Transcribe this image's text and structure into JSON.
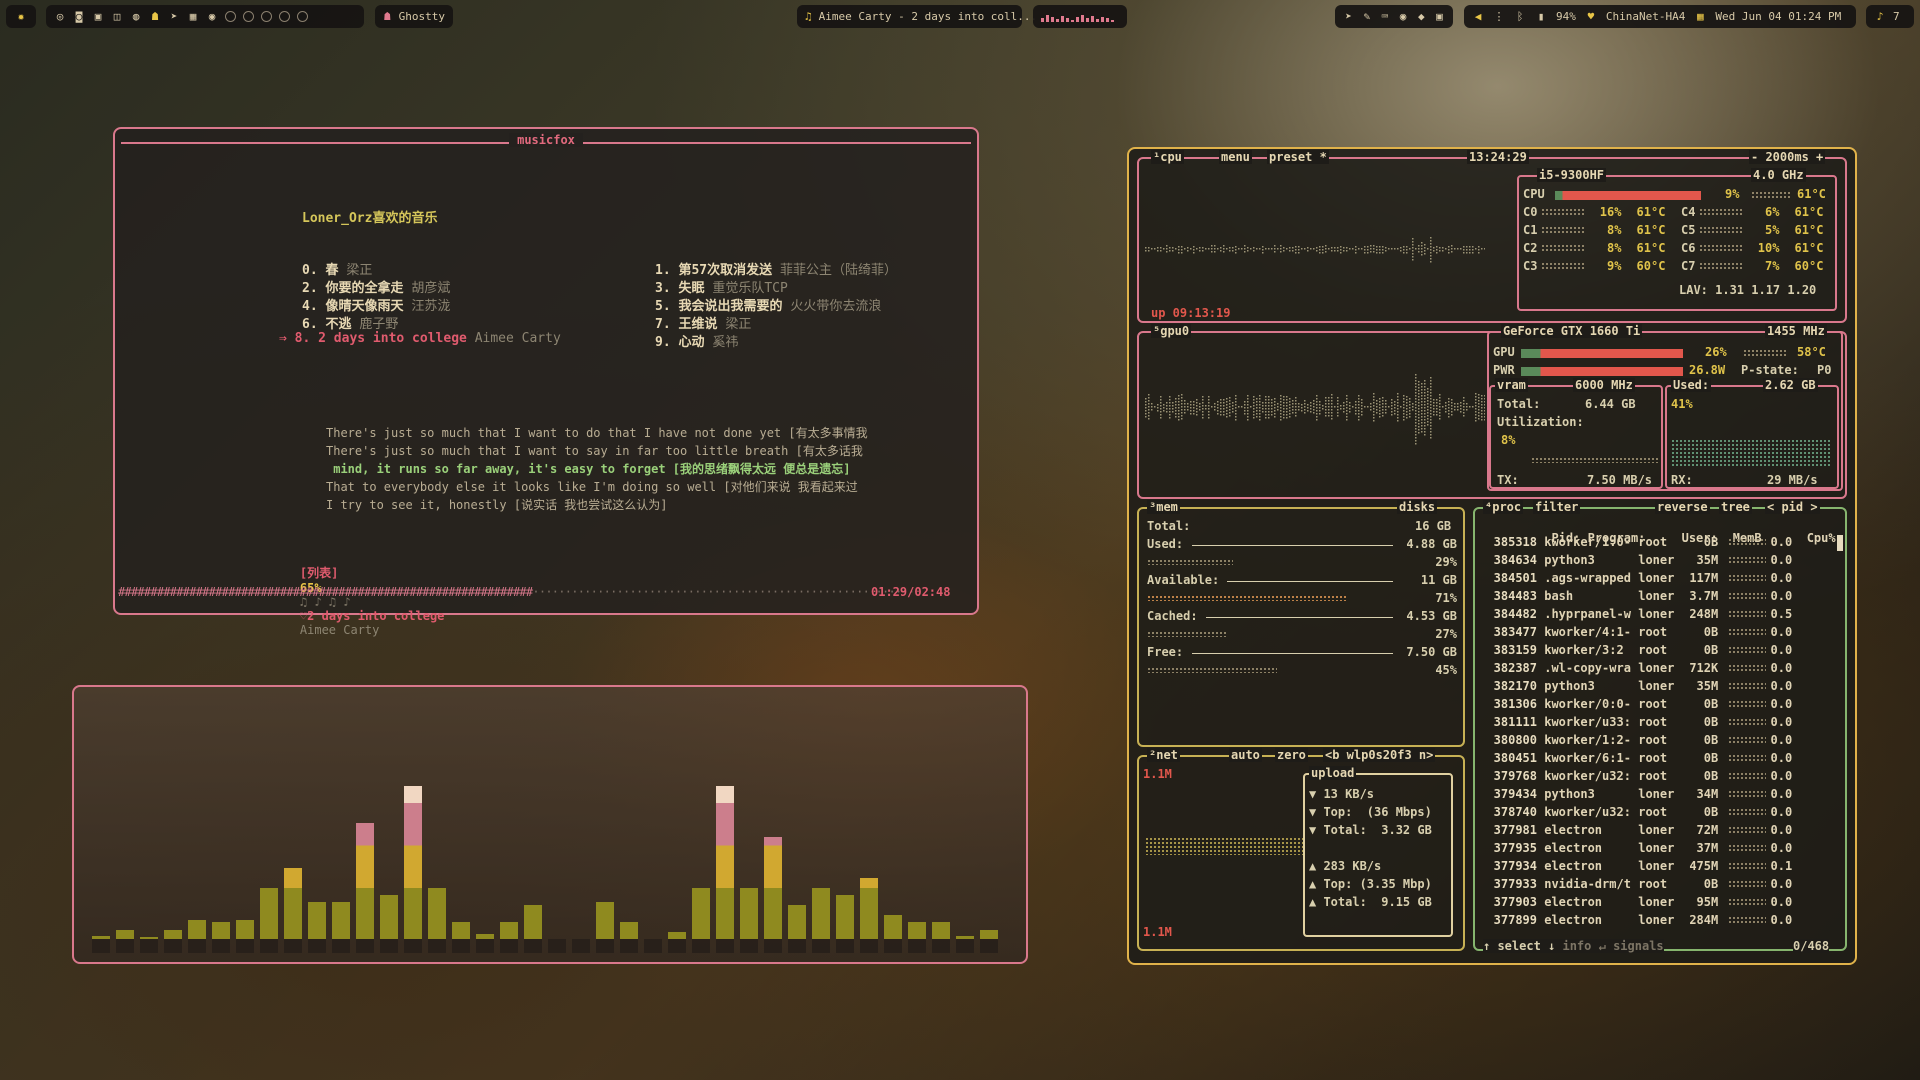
{
  "topbar": {
    "app_label": "Ghostty",
    "now_playing": "Aimee Carty - 2 days into coll...",
    "battery": "94%",
    "wifi": "ChinaNet-HA4",
    "datetime": "Wed Jun 04  01:24 PM",
    "notif_count": "7"
  },
  "musicfox": {
    "title": "musicfox",
    "playlist_title": "Loner_Orz喜欢的音乐",
    "songs_left": [
      {
        "num": "0.",
        "title": "春",
        "artist": "梁正"
      },
      {
        "num": "2.",
        "title": "你要的全拿走",
        "artist": "胡彦斌"
      },
      {
        "num": "4.",
        "title": "像晴天像雨天",
        "artist": "汪苏泷"
      },
      {
        "num": "6.",
        "title": "不逃",
        "artist": "鹿子野"
      }
    ],
    "playing_row": {
      "marker": "⇒",
      "num": "8.",
      "title": "2 days into college",
      "artist": "Aimee Carty"
    },
    "songs_right": [
      {
        "num": "1.",
        "title": "第57次取消发送",
        "artist": "菲菲公主（陆绮菲）"
      },
      {
        "num": "3.",
        "title": "失眠",
        "artist": "重觉乐队TCP"
      },
      {
        "num": "5.",
        "title": "我会说出我需要的",
        "artist": "火火带你去流浪"
      },
      {
        "num": "7.",
        "title": "王维说",
        "artist": "梁正"
      },
      {
        "num": "9.",
        "title": "心动",
        "artist": "奚祎"
      }
    ],
    "lyrics": [
      "There's just so much that I want to do that I have not done yet [有太多事情我",
      "There's just so much that I want to say in far too little breath [有太多话我",
      " mind, it runs so far away, it's easy to forget [我的思绪飘得太远 便总是遗忘]",
      "That to everybody else it looks like I'm doing so well [对他们来说 我看起来过",
      "I try to see it, honestly [说实话 我也尝试这么认为]"
    ],
    "status": {
      "list_tag": "[列表]",
      "volume": "65%",
      "notes": "♫ ♪ ♫ ♪",
      "heart": "♡",
      "song": "2 days into college",
      "artist": "Aimee Carty"
    },
    "progress": 0.607,
    "progress_bar": {
      "done": "################################################################",
      "remain": "···························································"
    },
    "time": "01:29/02:48"
  },
  "visualizer": {
    "bars": [
      0.02,
      0.05,
      0.01,
      0.05,
      0.11,
      0.1,
      0.11,
      0.3,
      0.42,
      0.22,
      0.22,
      0.68,
      0.26,
      0.9,
      0.3,
      0.1,
      0.03,
      0.1,
      0.2,
      0,
      0,
      0.22,
      0.1,
      0,
      0.04,
      0.3,
      0.9,
      0.3,
      0.6,
      0.2,
      0.3,
      0.26,
      0.36,
      0.14,
      0.1,
      0.1,
      0.02,
      0.05
    ],
    "colors": {
      "low": "#8f8a1f",
      "mid": "#d1a830",
      "high": "#cc7e8c",
      "top": "#f1d7c2"
    }
  },
  "btop": {
    "cpu": {
      "label": "¹cpu",
      "menu": "menu",
      "preset": "preset *",
      "clock": "13:24:29",
      "interval": "- 2000ms +",
      "uptime": "up 09:13:19",
      "model": "i5-9300HF",
      "freq": "4.0 GHz",
      "total": {
        "name": "CPU",
        "pct": "9%",
        "temp": "61°C",
        "value": 0.9
      },
      "cores_left": [
        {
          "name": "C0",
          "pct": "16%",
          "temp": "61°C"
        },
        {
          "name": "C1",
          "pct": "8%",
          "temp": "61°C"
        },
        {
          "name": "C2",
          "pct": "8%",
          "temp": "61°C"
        },
        {
          "name": "C3",
          "pct": "9%",
          "temp": "60°C"
        }
      ],
      "cores_right": [
        {
          "name": "C4",
          "pct": "6%",
          "temp": "61°C"
        },
        {
          "name": "C5",
          "pct": "5%",
          "temp": "61°C"
        },
        {
          "name": "C6",
          "pct": "10%",
          "temp": "61°C"
        },
        {
          "name": "C7",
          "pct": "7%",
          "temp": "60°C"
        }
      ],
      "load_avg": "LAV: 1.31 1.17 1.20"
    },
    "gpu": {
      "label": "⁵gpu0",
      "model": "GeForce GTX 1660 Ti",
      "clock": "1455 MHz",
      "gpu_row": {
        "name": "GPU",
        "pct": "26%",
        "temp": "58°C",
        "value": 0.95
      },
      "pwr_row": {
        "name": "PWR",
        "watts": "26.8W",
        "pstate": "P-state:",
        "pstate_val": "P0",
        "value": 0.95
      },
      "vram_label": "vram",
      "vram_clock": "6000 MHz",
      "used_label": "Used:",
      "used_val": "2.62 GB",
      "total_label": "Total:",
      "total_val": "6.44 GB",
      "used_pct": "41%",
      "util_label": "Utilization:",
      "util_val": "8%",
      "tx_label": "TX:",
      "tx_val": "7.50 MB/s",
      "rx_label": "RX:",
      "rx_val": "29 MB/s"
    },
    "mem": {
      "label": "³mem",
      "disks": "disks",
      "total_label": "Total:",
      "total_val": "16 GB",
      "rows": [
        {
          "label": "Used:",
          "val": "4.88 GB",
          "pct": "29%",
          "value": 0.29
        },
        {
          "label": "Available:",
          "val": "11 GB",
          "pct": "71%",
          "value": 0.71
        },
        {
          "label": "Cached:",
          "val": "4.53 GB",
          "pct": "27%",
          "value": 0.27
        },
        {
          "label": "Free:",
          "val": "7.50 GB",
          "pct": "45%",
          "value": 0.45
        }
      ]
    },
    "net": {
      "label": "²net",
      "auto": "auto",
      "zero": "zero",
      "iface": "<b wlp0s20f3 n>",
      "top_scale": "1.1M",
      "bottom_scale": "1.1M",
      "box_title": "upload",
      "download": {
        "rate": "13 KB/s",
        "top": "Top:  (36 Mbps)",
        "total": "Total:  3.32 GB"
      },
      "upload": {
        "rate": "283 KB/s",
        "top": "Top: (3.35 Mbp)",
        "total": "Total:  9.15 GB"
      }
    },
    "proc": {
      "label": "⁴proc",
      "filter": "filter",
      "reverse": "reverse",
      "tree": "tree",
      "sort": "< pid >",
      "headers": {
        "pid": "Pid:",
        "program": "Program:",
        "user": "User:",
        "mem": "MemB",
        "cpu": "Cpu%"
      },
      "rows": [
        {
          "pid": "385318",
          "program": "kworker/1:0-",
          "user": "root",
          "mem": "0B",
          "cpu": "0.0"
        },
        {
          "pid": "384634",
          "program": "python3",
          "user": "loner",
          "mem": "35M",
          "cpu": "0.0"
        },
        {
          "pid": "384501",
          "program": ".ags-wrapped",
          "user": "loner",
          "mem": "117M",
          "cpu": "0.0"
        },
        {
          "pid": "384483",
          "program": "bash",
          "user": "loner",
          "mem": "3.7M",
          "cpu": "0.0"
        },
        {
          "pid": "384482",
          "program": ".hyprpanel-w",
          "user": "loner",
          "mem": "248M",
          "cpu": "0.5"
        },
        {
          "pid": "383477",
          "program": "kworker/4:1-",
          "user": "root",
          "mem": "0B",
          "cpu": "0.0"
        },
        {
          "pid": "383159",
          "program": "kworker/3:2",
          "user": "root",
          "mem": "0B",
          "cpu": "0.0"
        },
        {
          "pid": "382387",
          "program": ".wl-copy-wra",
          "user": "loner",
          "mem": "712K",
          "cpu": "0.0"
        },
        {
          "pid": "382170",
          "program": "python3",
          "user": "loner",
          "mem": "35M",
          "cpu": "0.0"
        },
        {
          "pid": "381306",
          "program": "kworker/0:0-",
          "user": "root",
          "mem": "0B",
          "cpu": "0.0"
        },
        {
          "pid": "381111",
          "program": "kworker/u33:",
          "user": "root",
          "mem": "0B",
          "cpu": "0.0"
        },
        {
          "pid": "380800",
          "program": "kworker/1:2-",
          "user": "root",
          "mem": "0B",
          "cpu": "0.0"
        },
        {
          "pid": "380451",
          "program": "kworker/6:1-",
          "user": "root",
          "mem": "0B",
          "cpu": "0.0"
        },
        {
          "pid": "379768",
          "program": "kworker/u32:",
          "user": "root",
          "mem": "0B",
          "cpu": "0.0"
        },
        {
          "pid": "379434",
          "program": "python3",
          "user": "loner",
          "mem": "34M",
          "cpu": "0.0"
        },
        {
          "pid": "378740",
          "program": "kworker/u32:",
          "user": "root",
          "mem": "0B",
          "cpu": "0.0"
        },
        {
          "pid": "377981",
          "program": "electron",
          "user": "loner",
          "mem": "72M",
          "cpu": "0.0"
        },
        {
          "pid": "377935",
          "program": "electron",
          "user": "loner",
          "mem": "37M",
          "cpu": "0.0"
        },
        {
          "pid": "377934",
          "program": "electron",
          "user": "loner",
          "mem": "475M",
          "cpu": "0.1"
        },
        {
          "pid": "377933",
          "program": "nvidia-drm/t",
          "user": "root",
          "mem": "0B",
          "cpu": "0.0"
        },
        {
          "pid": "377903",
          "program": "electron",
          "user": "loner",
          "mem": "95M",
          "cpu": "0.0"
        },
        {
          "pid": "377899",
          "program": "electron",
          "user": "loner",
          "mem": "284M",
          "cpu": "0.0"
        }
      ],
      "footer": {
        "select": "↑ select ↓",
        "info": "info ↵",
        "signals": "signals",
        "count": "0/468"
      }
    }
  }
}
